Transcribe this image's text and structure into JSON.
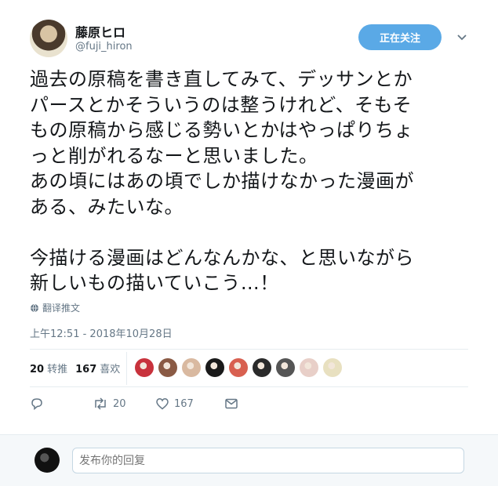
{
  "user": {
    "display_name": "藤原ヒロ",
    "handle": "@fuji_hiron"
  },
  "follow_button": "正在关注",
  "tweet": {
    "text": "過去の原稿を書き直してみて、デッサンとか\nパースとかそういうのは整うけれど、そもそ\nもの原稿から感じる勢いとかはやっぱりちょ\nっと削がれるなーと思いました。\nあの頃にはあの頃でしか描けなかった漫画が\nある、みたいな。\n\n今描ける漫画はどんなんかな、と思いながら\n新しいもの描いていこう…！",
    "translate_label": "翻译推文",
    "timestamp": "上午12:51 - 2018年10月28日"
  },
  "stats": {
    "retweets_count": "20",
    "retweets_label": "转推",
    "likes_count": "167",
    "likes_label": "喜欢"
  },
  "likers": [
    {
      "color": "#c8323c"
    },
    {
      "color": "#8a5a44"
    },
    {
      "color": "#d9b9a0"
    },
    {
      "color": "#1a1a1a"
    },
    {
      "color": "#d86050"
    },
    {
      "color": "#2a2a2a"
    },
    {
      "color": "#555555"
    },
    {
      "color": "#e8cfc8"
    },
    {
      "color": "#e8e0c0"
    }
  ],
  "actions": {
    "retweet_count": "20",
    "like_count": "167"
  },
  "reply": {
    "placeholder": "发布你的回复"
  }
}
